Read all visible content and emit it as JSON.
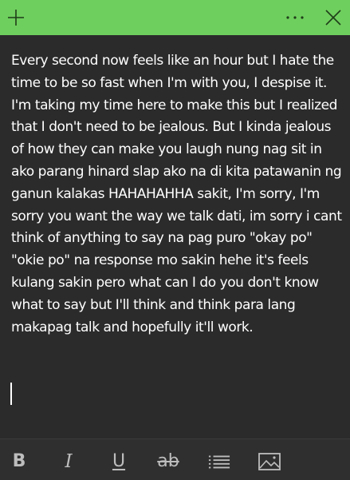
{
  "titlebar": {
    "color": "#6fcf5e",
    "icons": [
      "plus-icon",
      "more-options-icon",
      "close-icon"
    ]
  },
  "note": {
    "text": "Every second now feels like an hour but I hate the time to be so fast when I'm with you, I despise it. I'm taking my time here to make this but I realized that I don't need to be jealous. But I kinda jealous of how they can make you laugh nung nag sit in ako parang hinard slap ako na di kita patawanin ng ganun kalakas HAHAHAHHA sakit, I'm sorry, I'm sorry you want the way we talk dati, im sorry i cant think of anything to say na pag puro \"okay po\" \"okie po\" na response mo sakin hehe it's feels kulang sakin pero what can I do you don't know what to say but I'll think and think para lang makapag talk and hopefully it'll work."
  },
  "toolbar": {
    "bold_glyph": "B",
    "italic_glyph": "I",
    "underline_glyph": "U",
    "strikethrough_glyph": "ab",
    "icons": [
      "bullet-list-icon",
      "image-icon"
    ]
  }
}
